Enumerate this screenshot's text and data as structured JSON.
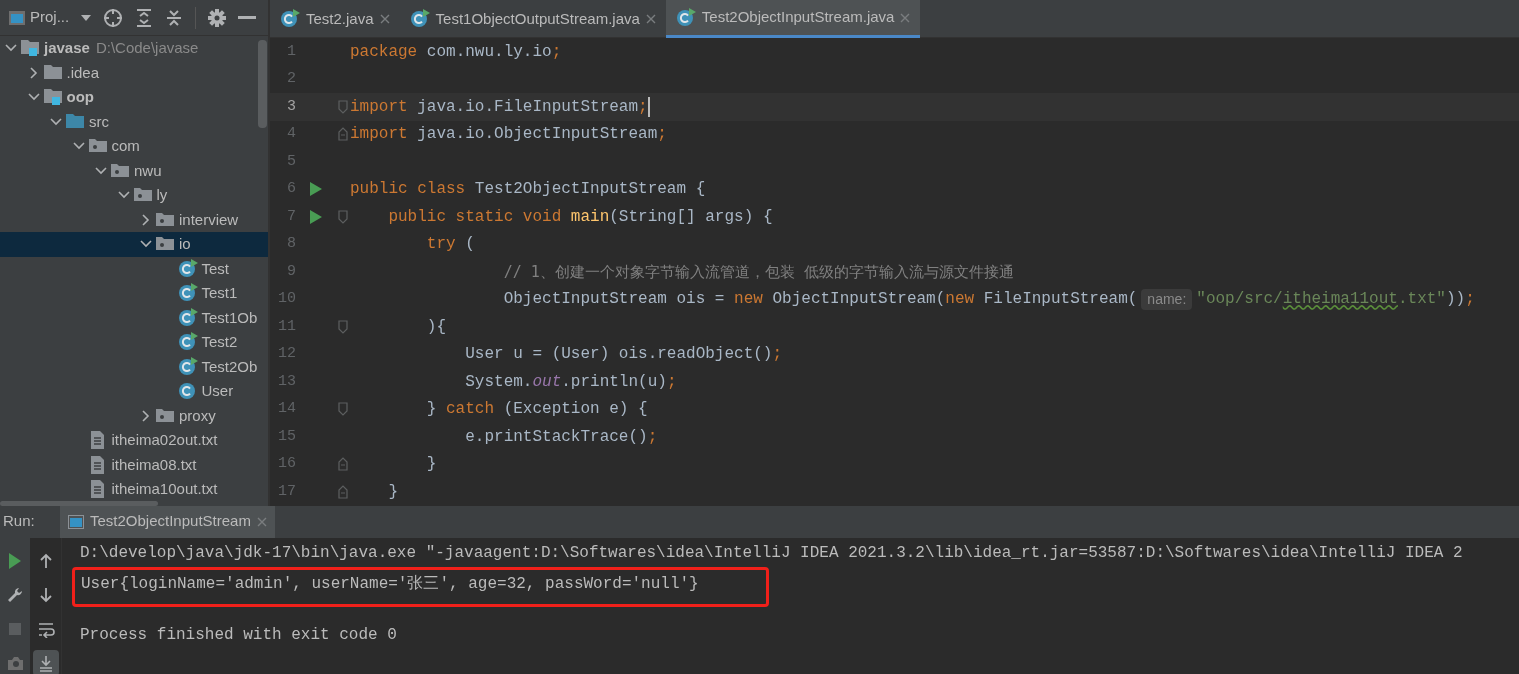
{
  "project_panel": {
    "title": "Proj...",
    "tree": [
      {
        "label": "javase",
        "path": "D:\\Code\\javase",
        "kind": "module",
        "expanded": true,
        "selected": false,
        "children": [
          {
            "label": ".idea",
            "kind": "folder",
            "expanded": false,
            "selected": false
          },
          {
            "label": "oop",
            "kind": "module",
            "expanded": true,
            "selected": false,
            "children": [
              {
                "label": "src",
                "kind": "source",
                "expanded": true,
                "selected": false,
                "children": [
                  {
                    "label": "com",
                    "kind": "package",
                    "expanded": true,
                    "selected": false,
                    "children": [
                      {
                        "label": "nwu",
                        "kind": "package",
                        "expanded": true,
                        "selected": false,
                        "children": [
                          {
                            "label": "ly",
                            "kind": "package",
                            "expanded": true,
                            "selected": false,
                            "children": [
                              {
                                "label": "interview",
                                "kind": "package",
                                "expanded": false,
                                "selected": false
                              },
                              {
                                "label": "io",
                                "kind": "package",
                                "expanded": true,
                                "selected": true,
                                "children": [
                                  {
                                    "label": "Test",
                                    "kind": "runnable_class",
                                    "selected": false
                                  },
                                  {
                                    "label": "Test1",
                                    "kind": "runnable_class",
                                    "selected": false
                                  },
                                  {
                                    "label": "Test1Ob",
                                    "kind": "runnable_class",
                                    "selected": false
                                  },
                                  {
                                    "label": "Test2",
                                    "kind": "runnable_class",
                                    "selected": false
                                  },
                                  {
                                    "label": "Test2Ob",
                                    "kind": "runnable_class",
                                    "selected": false
                                  },
                                  {
                                    "label": "User",
                                    "kind": "class",
                                    "selected": false
                                  }
                                ]
                              },
                              {
                                "label": "proxy",
                                "kind": "package",
                                "expanded": false,
                                "selected": false
                              }
                            ]
                          }
                        ]
                      }
                    ]
                  },
                  {
                    "label": "itheima02out.txt",
                    "kind": "text_file",
                    "selected": false
                  },
                  {
                    "label": "itheima08.txt",
                    "kind": "text_file",
                    "selected": false
                  },
                  {
                    "label": "itheima10out.txt",
                    "kind": "text_file",
                    "selected": false
                  }
                ]
              }
            ]
          }
        ]
      }
    ]
  },
  "editor_tabs": [
    {
      "label": "Test2.java",
      "selected": false
    },
    {
      "label": "Test1ObjectOutputStream.java",
      "selected": false
    },
    {
      "label": "Test2ObjectInputStream.java",
      "selected": true
    }
  ],
  "code_lines": [
    {
      "number": "1",
      "current": false,
      "runnable": false,
      "segments": [
        {
          "kind": "keyword",
          "text": "package"
        },
        {
          "kind": "plain",
          "text": " com.nwu.ly.io"
        },
        {
          "kind": "keyword",
          "text": ";"
        }
      ]
    },
    {
      "number": "2",
      "current": false,
      "runnable": false
    },
    {
      "number": "3",
      "current": true,
      "runnable": false,
      "kind": "fold_start",
      "segments": [
        {
          "kind": "keyword",
          "text": "import"
        },
        {
          "kind": "plain",
          "text": " java.io.FileInputStream"
        },
        {
          "kind": "keyword",
          "text": ";"
        }
      ]
    },
    {
      "number": "4",
      "current": false,
      "runnable": false,
      "kind": "fold_end",
      "segments": [
        {
          "kind": "keyword",
          "text": "import"
        },
        {
          "kind": "plain",
          "text": " java.io.ObjectInputStream"
        },
        {
          "kind": "keyword",
          "text": ";"
        }
      ]
    },
    {
      "number": "5",
      "current": false,
      "runnable": false
    },
    {
      "number": "6",
      "current": false,
      "runnable": true,
      "segments": [
        {
          "kind": "keyword",
          "text": "public class"
        },
        {
          "kind": "plain",
          "text": " Test2ObjectInputStream {"
        }
      ]
    },
    {
      "number": "7",
      "current": false,
      "runnable": true,
      "kind": "fold_start",
      "segments": [
        {
          "kind": "keyword",
          "text": "    public static void "
        },
        {
          "kind": "method",
          "text": "main"
        },
        {
          "kind": "plain",
          "text": "(String[] args) {"
        }
      ]
    },
    {
      "number": "8",
      "current": false,
      "runnable": false,
      "segments": [
        {
          "kind": "keyword",
          "text": "        try"
        },
        {
          "kind": "plain",
          "text": " ("
        }
      ]
    },
    {
      "number": "9",
      "current": false,
      "runnable": false,
      "segments": [
        {
          "kind": "comment",
          "text": "                // 1、创建一个对象字节输入流管道，包装 低级的字节输入流与源文件接通"
        }
      ]
    },
    {
      "number": "10",
      "current": false,
      "runnable": false,
      "segments": [
        {
          "kind": "plain",
          "text": "                ObjectInputStream ois = "
        },
        {
          "kind": "keyword",
          "text": "new"
        },
        {
          "kind": "plain",
          "text": " ObjectInputStream("
        },
        {
          "kind": "keyword",
          "text": "new"
        },
        {
          "kind": "plain",
          "text": " FileInputStream("
        },
        {
          "kind": "hint",
          "text": "name:"
        },
        {
          "kind": "string",
          "text": "\"oop/src/"
        },
        {
          "kind": "typo",
          "text": "itheima11out"
        },
        {
          "kind": "string",
          "text": ".txt\""
        },
        {
          "kind": "plain",
          "text": "))"
        },
        {
          "kind": "keyword",
          "text": ";"
        }
      ]
    },
    {
      "number": "11",
      "current": false,
      "runnable": false,
      "kind": "fold_start",
      "segments": [
        {
          "kind": "plain",
          "text": "        ){"
        }
      ]
    },
    {
      "number": "12",
      "current": false,
      "runnable": false,
      "segments": [
        {
          "kind": "plain",
          "text": "            User u = (User) ois.readObject()"
        },
        {
          "kind": "keyword",
          "text": ";"
        }
      ]
    },
    {
      "number": "13",
      "current": false,
      "runnable": false,
      "segments": [
        {
          "kind": "plain",
          "text": "            System."
        },
        {
          "kind": "static_field",
          "text": "out"
        },
        {
          "kind": "plain",
          "text": ".println(u)"
        },
        {
          "kind": "keyword",
          "text": ";"
        }
      ]
    },
    {
      "number": "14",
      "current": false,
      "runnable": false,
      "kind": "fold_start",
      "segments": [
        {
          "kind": "plain",
          "text": "        } "
        },
        {
          "kind": "keyword",
          "text": "catch"
        },
        {
          "kind": "plain",
          "text": " (Exception e) {"
        }
      ]
    },
    {
      "number": "15",
      "current": false,
      "runnable": false,
      "segments": [
        {
          "kind": "plain",
          "text": "            e.printStackTrace()"
        },
        {
          "kind": "keyword",
          "text": ";"
        }
      ]
    },
    {
      "number": "16",
      "current": false,
      "runnable": false,
      "kind": "fold_end",
      "segments": [
        {
          "kind": "plain",
          "text": "        }"
        }
      ]
    },
    {
      "number": "17",
      "current": false,
      "runnable": false,
      "kind": "fold_end",
      "segments": [
        {
          "kind": "plain",
          "text": "    }"
        }
      ]
    }
  ],
  "run_panel": {
    "label": "Run:",
    "tab": "Test2ObjectInputStream",
    "left_tools": [
      {
        "kind": "rerun",
        "disabled": false
      },
      {
        "kind": "settings",
        "disabled": false
      },
      {
        "kind": "stop",
        "disabled": true
      },
      {
        "kind": "camera",
        "disabled": false
      }
    ],
    "right_tools": [
      {
        "kind": "up",
        "on": false
      },
      {
        "kind": "down",
        "on": false
      },
      {
        "kind": "soft_wrap",
        "on": false
      },
      {
        "kind": "scroll_end",
        "on": true
      }
    ],
    "console": [
      {
        "text": "D:\\develop\\java\\jdk-17\\bin\\java.exe \"-javaagent:D:\\Softwares\\idea\\IntelliJ IDEA 2021.3.2\\lib\\idea_rt.jar=53587:D:\\Softwares\\idea\\IntelliJ IDEA 2",
        "highlighted": false
      },
      {
        "text": "User{loginName='admin', userName='张三', age=32, passWord='null'}",
        "highlighted": true
      },
      {
        "text": "Process finished with exit code 0",
        "highlighted": false
      }
    ]
  }
}
